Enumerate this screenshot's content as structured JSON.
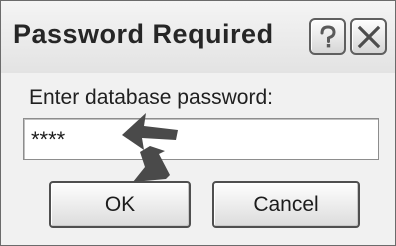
{
  "dialog": {
    "title": "Password Required",
    "help_icon": "question-mark-icon",
    "close_icon": "close-x-icon",
    "prompt_label": "Enter database password:",
    "password_value": "****",
    "ok_label": "OK",
    "cancel_label": "Cancel"
  },
  "colors": {
    "window_bg": "#f1f1f1",
    "border": "#5f5f5f",
    "annotation_arrow": "#4a4a4a"
  }
}
